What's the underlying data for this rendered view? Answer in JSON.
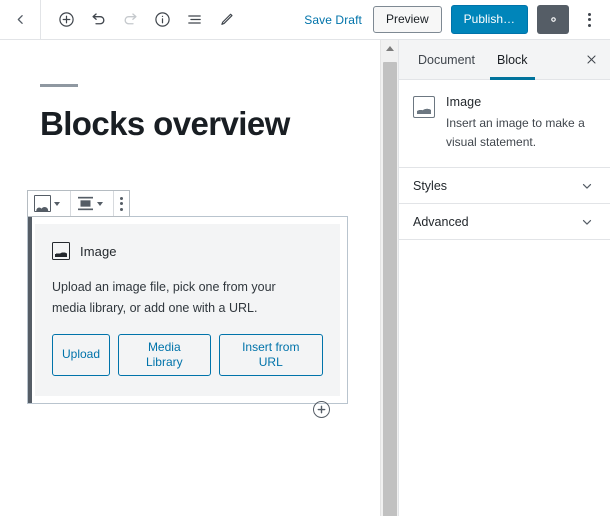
{
  "topbar": {
    "back_icon": "chevron-left-icon",
    "tools": [
      {
        "name": "add-block-button",
        "icon": "circle-plus-icon",
        "disabled": false
      },
      {
        "name": "undo-button",
        "icon": "undo-icon",
        "disabled": false
      },
      {
        "name": "redo-button",
        "icon": "redo-icon",
        "disabled": true
      },
      {
        "name": "content-info-button",
        "icon": "circle-info-icon",
        "disabled": false
      },
      {
        "name": "block-navigation-button",
        "icon": "list-view-icon",
        "disabled": false
      },
      {
        "name": "edit-mode-button",
        "icon": "pencil-icon",
        "disabled": false
      }
    ],
    "save_draft_label": "Save Draft",
    "preview_label": "Preview",
    "publish_label": "Publish…",
    "settings_icon": "gear-icon",
    "more_menu_icon": "kebab-menu-icon"
  },
  "editor": {
    "title": "Blocks overview",
    "block_toolbar": {
      "block_type_icon": "image-icon",
      "block_type_caret": "chevron-down-icon",
      "align_icon": "align-center-icon",
      "align_caret": "chevron-down-icon",
      "more_options_icon": "kebab-menu-icon"
    },
    "image_block": {
      "icon": "image-icon",
      "title": "Image",
      "description": "Upload an image file, pick one from your media library, or add one with a URL.",
      "buttons": [
        {
          "name": "upload-button",
          "label": "Upload"
        },
        {
          "name": "media-library-button",
          "label": "Media Library"
        },
        {
          "name": "insert-from-url-button",
          "label": "Insert from URL"
        }
      ]
    },
    "inserter_icon": "circle-plus-icon",
    "scrollbar": {
      "up_arrow_icon": "triangle-up-icon"
    }
  },
  "sidebar": {
    "tabs": [
      {
        "name": "tab-document",
        "label": "Document",
        "active": false
      },
      {
        "name": "tab-block",
        "label": "Block",
        "active": true
      }
    ],
    "close_icon": "close-icon",
    "block_card": {
      "icon": "image-icon",
      "title": "Image",
      "description": "Insert an image to make a visual statement."
    },
    "panels": [
      {
        "name": "panel-styles",
        "label": "Styles",
        "icon": "chevron-down-icon"
      },
      {
        "name": "panel-advanced",
        "label": "Advanced",
        "icon": "chevron-down-icon"
      }
    ]
  },
  "colors": {
    "accent_blue": "#0085ba",
    "link_blue": "#0073aa",
    "tab_underline": "#00739c",
    "border_gray": "#e2e4e7",
    "dark_gray": "#555d66",
    "placeholder_bg": "#f3f4f5"
  }
}
